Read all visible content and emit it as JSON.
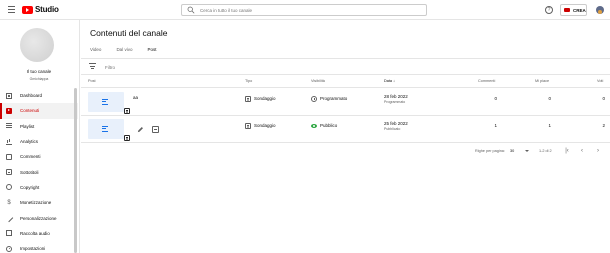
{
  "app": {
    "logo_text": "Studio"
  },
  "header": {
    "search_placeholder": "Cerca in tutto il tuo canale",
    "create_label": "CREA",
    "brand_color": "#cc0000"
  },
  "sidebar": {
    "channel_title": "Il tuo canale",
    "channel_name": "Gmichiappa",
    "items": [
      {
        "label": "Dashboard",
        "icon": "dashboard-icon",
        "active": false
      },
      {
        "label": "Contenuti",
        "icon": "content-icon",
        "active": true
      },
      {
        "label": "Playlist",
        "icon": "playlist-icon",
        "active": false
      },
      {
        "label": "Analytics",
        "icon": "analytics-icon",
        "active": false
      },
      {
        "label": "Commenti",
        "icon": "comments-icon",
        "active": false
      },
      {
        "label": "Sottotitoli",
        "icon": "subtitles-icon",
        "active": false
      },
      {
        "label": "Copyright",
        "icon": "copyright-icon",
        "active": false
      },
      {
        "label": "Monetizzazione",
        "icon": "monetization-icon",
        "active": false
      },
      {
        "label": "Personalizzazione",
        "icon": "customization-icon",
        "active": false
      },
      {
        "label": "Raccolta audio",
        "icon": "audio-library-icon",
        "active": false
      },
      {
        "label": "Impostazioni",
        "icon": "settings-icon",
        "active": false
      }
    ]
  },
  "main": {
    "title": "Contenuti del canale",
    "tabs": [
      {
        "label": "Video",
        "active": false
      },
      {
        "label": "Dal vivo",
        "active": false
      },
      {
        "label": "Post",
        "active": true
      }
    ],
    "filter_placeholder": "Filtro",
    "columns": {
      "post": "Post",
      "type": "Tipo",
      "visibility": "Visibilità",
      "date": "Data",
      "date_sort": "↓",
      "comments": "Commenti",
      "likes": "Mi piace",
      "votes": "Voti"
    },
    "rows": [
      {
        "text": "aa",
        "type": "Sondaggio",
        "visibility": "Programmato",
        "visibility_icon": "clock-icon",
        "date": "28 feb 2022",
        "date_status": "Programmato",
        "comments": "0",
        "likes": "0",
        "votes": "0"
      },
      {
        "text": "",
        "type": "Sondaggio",
        "visibility": "Pubblico",
        "visibility_icon": "eye-icon",
        "date": "25 feb 2022",
        "date_status": "Pubblicato",
        "comments": "1",
        "likes": "1",
        "votes": "2"
      }
    ],
    "pagination": {
      "rows_per_page_label": "Righe per pagina:",
      "rows_per_page": "30",
      "range": "1-2 di 2"
    }
  }
}
